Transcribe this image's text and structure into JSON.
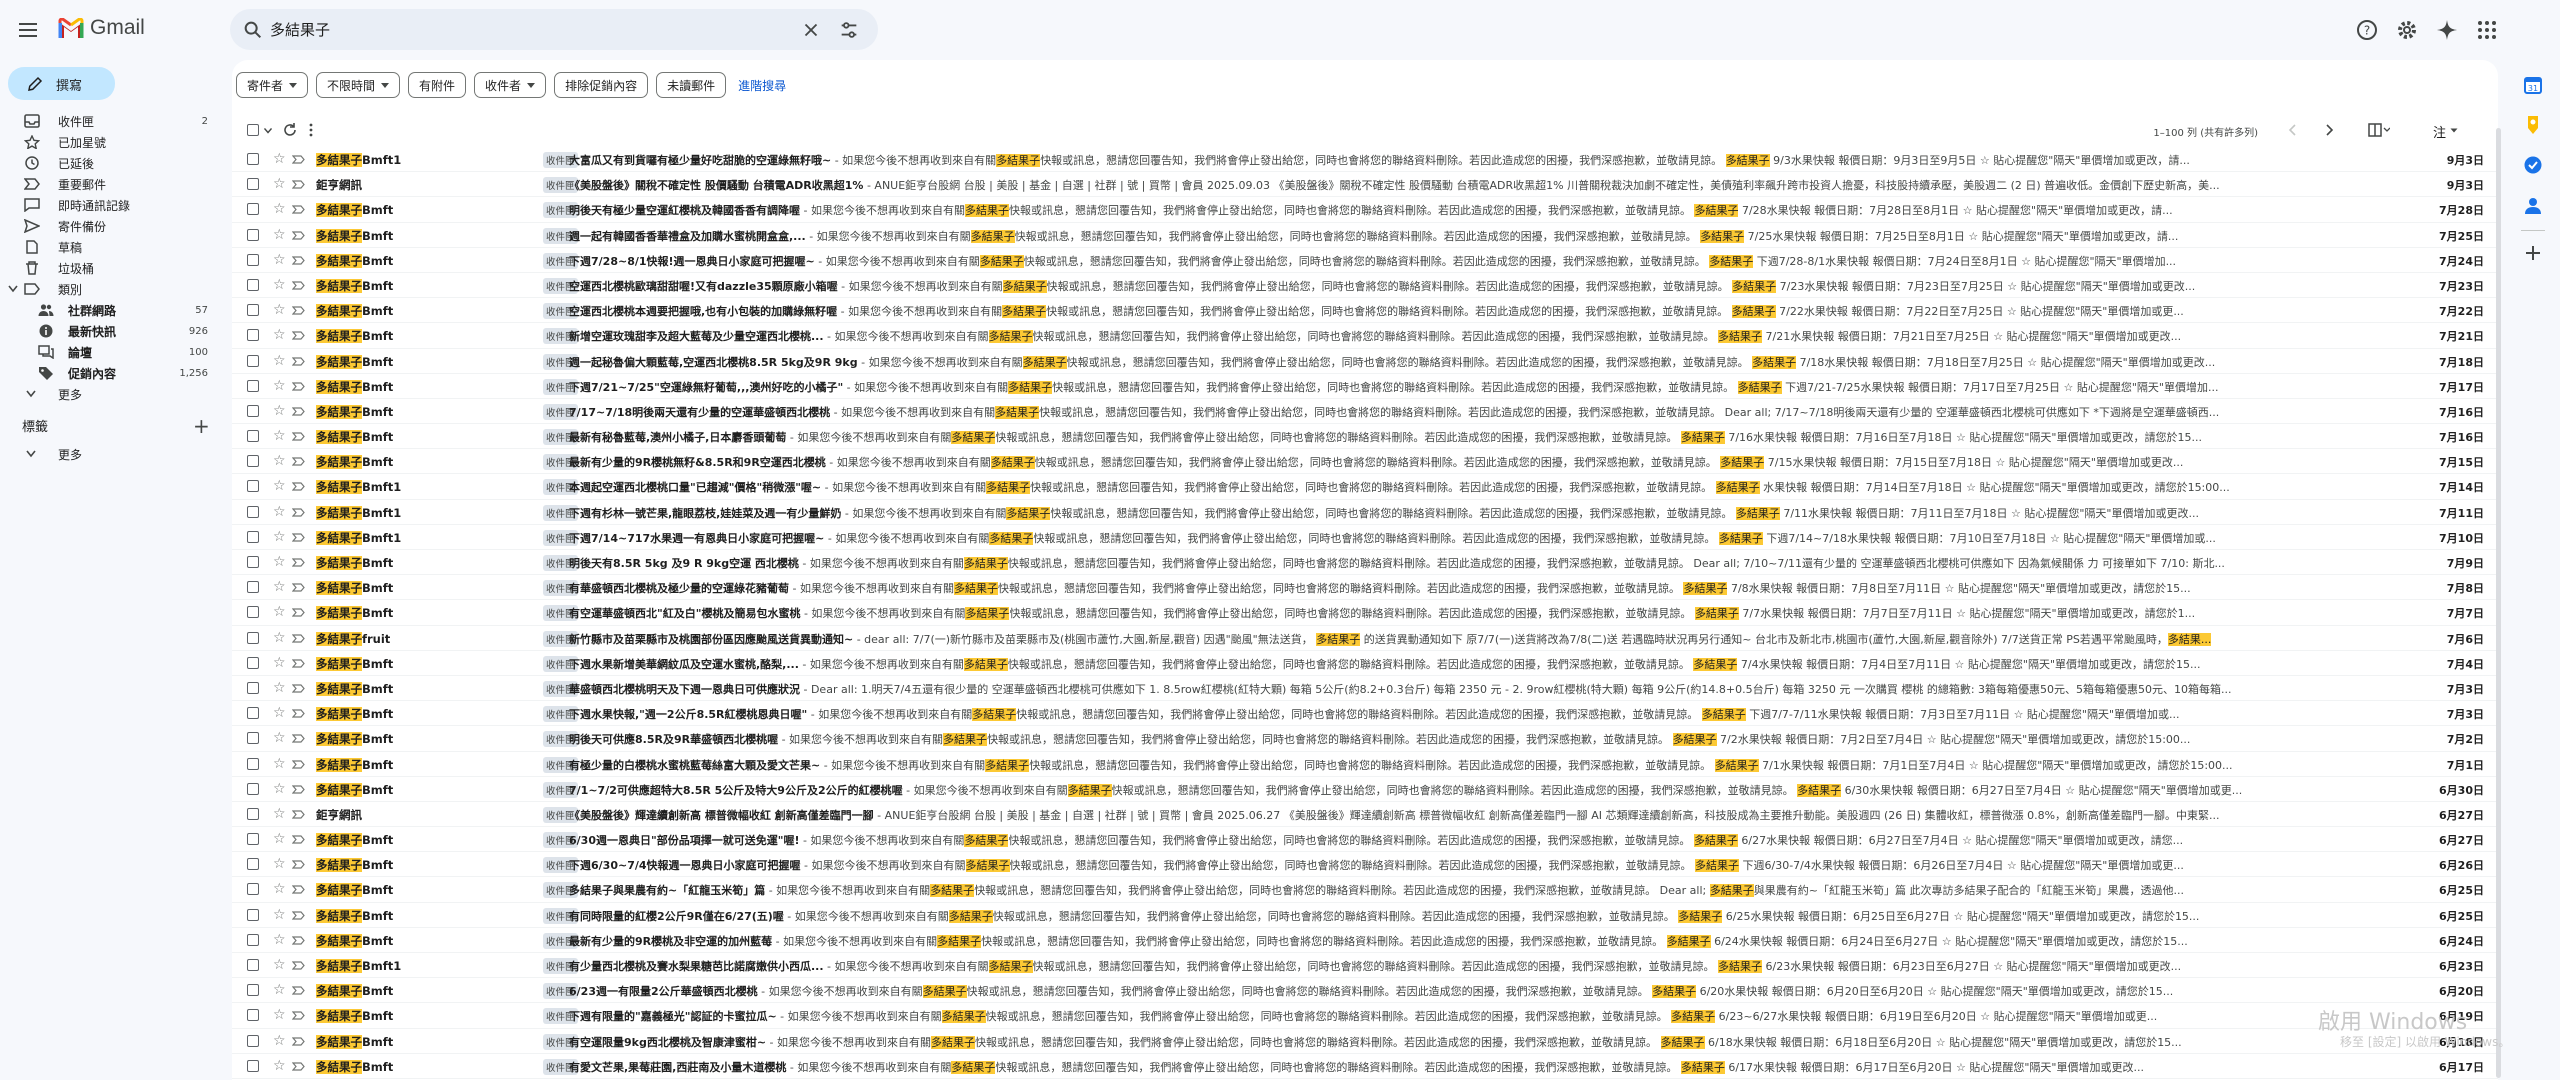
{
  "app": {
    "name": "Gmail"
  },
  "search": {
    "value": "多結果子"
  },
  "colors": {
    "accent": "#0b57d0",
    "highlight": "#fcc934",
    "compose_bg": "#c2e7ff"
  },
  "sidebar": {
    "compose": "撰寫",
    "items": [
      {
        "label": "收件匣",
        "count": "2",
        "icon": "inbox-icon"
      },
      {
        "label": "已加星號",
        "count": "",
        "icon": "star-icon"
      },
      {
        "label": "已延後",
        "count": "",
        "icon": "clock-icon"
      },
      {
        "label": "重要郵件",
        "count": "",
        "icon": "important-icon"
      },
      {
        "label": "即時通訊記錄",
        "count": "",
        "icon": "chat-icon"
      },
      {
        "label": "寄件備份",
        "count": "",
        "icon": "send-icon"
      },
      {
        "label": "草稿",
        "count": "",
        "icon": "draft-icon"
      },
      {
        "label": "垃圾桶",
        "count": "",
        "icon": "trash-icon"
      },
      {
        "label": "類別",
        "count": "",
        "icon": "label-icon"
      }
    ],
    "categories": [
      {
        "label": "社群網路",
        "count": "57",
        "icon": "people-icon"
      },
      {
        "label": "最新快訊",
        "count": "926",
        "icon": "info-icon"
      },
      {
        "label": "論壇",
        "count": "100",
        "icon": "forum-icon"
      },
      {
        "label": "促銷內容",
        "count": "1,256",
        "icon": "tag-icon"
      }
    ],
    "more": "更多",
    "labels_title": "標籤",
    "labels_more": "更多"
  },
  "filters": {
    "chips": [
      "寄件者",
      "不限時間",
      "有附件",
      "收件者",
      "排除促銷內容",
      "未讀郵件"
    ],
    "advanced": "進階搜尋"
  },
  "toolbar": {
    "range": "1–100 列 (共有許多列)",
    "sort": "注"
  },
  "inbox_badge": "收件匣",
  "rows": [
    {
      "sender_hl": "多結果子",
      "sender_rest": "Bmft1",
      "badge": true,
      "subject": "大富瓜又有到貨囉有極少量好吃甜脆的空運綠無籽哦~",
      "snippet_a": " - 如果您今後不想再收到來自有關",
      "snippet_hl": "多結果子",
      "snippet_b": "快報或訊息，懇請您回覆告知，我們將會停止發出給您，同時也會將您的聯絡資料刪除。若因此造成您的困擾，我們深感抱歉，並敬請見諒。 ",
      "tail_hl": "多結果子",
      "tail": " 9/3水果快報 報價日期：9月3日至9月5日 ☆ 貼心提醒您\"隔天\"單價增加或更改，請...",
      "date": "9月3日"
    },
    {
      "sender_hl": "",
      "sender_rest": "鉅亨網訊",
      "badge": true,
      "subject": "《美股盤後》關稅不確定性 股價騷動 台積電ADR收黑超1%",
      "snippet_a": " - ANUE鉅亨台股網 台股 | 美股 | 基金 | 自選 | 社群 | 號 | 買幣 | 會員 2025.09.03 《美股盤後》關稅不確定性 股價騷動 台積電ADR收黑超1% 川普關稅裁決加劇不確定性，美債殖利率飆升跨市投資人擔憂，科技股持續承壓，美股週二 (2 日) 普遍收低。金價創下歷史新高，美...",
      "snippet_hl": "",
      "snippet_b": "",
      "tail_hl": "",
      "tail": "",
      "date": "9月3日"
    },
    {
      "sender_hl": "多結果子",
      "sender_rest": "Bmft",
      "badge": true,
      "subject": "明後天有極少量空運紅櫻桃及韓國香香有調降喔",
      "snippet_a": " - 如果您今後不想再收到來自有關",
      "snippet_hl": "多結果子",
      "snippet_b": "快報或訊息，懇請您回覆告知，我們將會停止發出給您，同時也會將您的聯絡資料刪除。若因此造成您的困擾，我們深感抱歉，並敬請見諒。 ",
      "tail_hl": "多結果子",
      "tail": " 7/28水果快報 報價日期：7月28日至8月1日 ☆ 貼心提醒您\"隔天\"單價增加或更改，請...",
      "date": "7月28日"
    },
    {
      "sender_hl": "多結果子",
      "sender_rest": "Bmft",
      "badge": true,
      "subject": "週一起有韓國香香華禮盒及加購水蜜桃開盒盒,...",
      "snippet_a": " - 如果您今後不想再收到來自有關",
      "snippet_hl": "多結果子",
      "snippet_b": "快報或訊息，懇請您回覆告知，我們將會停止發出給您，同時也會將您的聯絡資料刪除。若因此造成您的困擾，我們深感抱歉，並敬請見諒。 ",
      "tail_hl": "多結果子",
      "tail": " 7/25水果快報 報價日期：7月25日至8月1日 ☆ 貼心提醒您\"隔天\"單價增加或更改，請...",
      "date": "7月25日"
    },
    {
      "sender_hl": "多結果子",
      "sender_rest": "Bmft",
      "badge": true,
      "subject": "下週7/28~8/1快報!週一恩典日小家庭可把握喔~",
      "snippet_a": " - 如果您今後不想再收到來自有關",
      "snippet_hl": "多結果子",
      "snippet_b": "快報或訊息，懇請您回覆告知，我們將會停止發出給您，同時也會將您的聯絡資料刪除。若因此造成您的困擾，我們深感抱歉，並敬請見諒。 ",
      "tail_hl": "多結果子",
      "tail": " 下週7/28-8/1水果快報 報價日期：7月24日至8月1日 ☆ 貼心提醒您\"隔天\"單價增加...",
      "date": "7月24日"
    },
    {
      "sender_hl": "多結果子",
      "sender_rest": "Bmft",
      "badge": true,
      "subject": "空運西北櫻桃歐璃甜甜喔!又有dazzle35顆原廠小箱喔",
      "snippet_a": " - 如果您今後不想再收到來自有關",
      "snippet_hl": "多結果子",
      "snippet_b": "快報或訊息，懇請您回覆告知，我們將會停止發出給您，同時也會將您的聯絡資料刪除。若因此造成您的困擾，我們深感抱歉，並敬請見諒。 ",
      "tail_hl": "多結果子",
      "tail": " 7/23水果快報 報價日期：7月23日至7月25日 ☆ 貼心提醒您\"隔天\"單價增加或更改...",
      "date": "7月23日"
    },
    {
      "sender_hl": "多結果子",
      "sender_rest": "Bmft",
      "badge": true,
      "subject": "空運西北櫻桃本週要把握哦,也有小包裝的加購綠無籽喔",
      "snippet_a": " - 如果您今後不想再收到來自有關",
      "snippet_hl": "多結果子",
      "snippet_b": "快報或訊息，懇請您回覆告知，我們將會停止發出給您，同時也會將您的聯絡資料刪除。若因此造成您的困擾，我們深感抱歉，並敬請見諒。 ",
      "tail_hl": "多結果子",
      "tail": " 7/22水果快報 報價日期：7月22日至7月25日 ☆ 貼心提醒您\"隔天\"單價增加或更...",
      "date": "7月22日"
    },
    {
      "sender_hl": "多結果子",
      "sender_rest": "Bmft",
      "badge": true,
      "subject": "新增空運玫瑰甜李及超大藍莓及少量空運西北櫻桃...",
      "snippet_a": " - 如果您今後不想再收到來自有關",
      "snippet_hl": "多結果子",
      "snippet_b": "快報或訊息，懇請您回覆告知，我們將會停止發出給您，同時也會將您的聯絡資料刪除。若因此造成您的困擾，我們深感抱歉，並敬請見諒。 ",
      "tail_hl": "多結果子",
      "tail": " 7/21水果快報 報價日期：7月21日至7月25日 ☆ 貼心提醒您\"隔天\"單價增加或更改...",
      "date": "7月21日"
    },
    {
      "sender_hl": "多結果子",
      "sender_rest": "Bmft",
      "badge": true,
      "subject": "週一起秘魯偏大顆藍莓,空運西北櫻桃8.5R 5kg及9R 9kg",
      "snippet_a": " - 如果您今後不想再收到來自有關",
      "snippet_hl": "多結果子",
      "snippet_b": "快報或訊息，懇請您回覆告知，我們將會停止發出給您，同時也會將您的聯絡資料刪除。若因此造成您的困擾，我們深感抱歉，並敬請見諒。 ",
      "tail_hl": "多結果子",
      "tail": " 7/18水果快報 報價日期：7月18日至7月25日 ☆ 貼心提醒您\"隔天\"單價增加或更改...",
      "date": "7月18日"
    },
    {
      "sender_hl": "多結果子",
      "sender_rest": "Bmft",
      "badge": true,
      "subject": "下週7/21~7/25\"空運綠無籽葡萄,,,澳州好吃的小橘子\"",
      "snippet_a": " - 如果您今後不想再收到來自有關",
      "snippet_hl": "多結果子",
      "snippet_b": "快報或訊息，懇請您回覆告知，我們將會停止發出給您，同時也會將您的聯絡資料刪除。若因此造成您的困擾，我們深感抱歉，並敬請見諒。 ",
      "tail_hl": "多結果子",
      "tail": " 下週7/21-7/25水果快報 報價日期：7月17日至7月25日 ☆ 貼心提醒您\"隔天\"單價增加...",
      "date": "7月17日"
    },
    {
      "sender_hl": "多結果子",
      "sender_rest": "Bmft",
      "badge": true,
      "subject": "7/17~7/18明後兩天還有少量的空運華盛頓西北櫻桃",
      "snippet_a": " - 如果您今後不想再收到來自有關",
      "snippet_hl": "多結果子",
      "snippet_b": "快報或訊息，懇請您回覆告知，我們將會停止發出給您，同時也會將您的聯絡資料刪除。若因此造成您的困擾，我們深感抱歉，並敬請見諒。 Dear all; 7/17~7/18明後兩天還有少量的 空運華盛頓西北櫻桃可供應如下 *下週將是空運華盛頓西...",
      "tail_hl": "",
      "tail": "",
      "date": "7月16日"
    },
    {
      "sender_hl": "多結果子",
      "sender_rest": "Bmft",
      "badge": true,
      "subject": "最新有秘魯藍莓,澳州小橘子,日本麝香頭葡萄",
      "snippet_a": " - 如果您今後不想再收到來自有關",
      "snippet_hl": "多結果子",
      "snippet_b": "快報或訊息，懇請您回覆告知，我們將會停止發出給您，同時也會將您的聯絡資料刪除。若因此造成您的困擾，我們深感抱歉，並敬請見諒。 ",
      "tail_hl": "多結果子",
      "tail": " 7/16水果快報 報價日期：7月16日至7月18日 ☆ 貼心提醒您\"隔天\"單價增加或更改，請您於15...",
      "date": "7月16日"
    },
    {
      "sender_hl": "多結果子",
      "sender_rest": "Bmft",
      "badge": true,
      "subject": "最新有少量的9R櫻桃無籽&8.5R和9R空運西北櫻桃",
      "snippet_a": " - 如果您今後不想再收到來自有關",
      "snippet_hl": "多結果子",
      "snippet_b": "快報或訊息，懇請您回覆告知，我們將會停止發出給您，同時也會將您的聯絡資料刪除。若因此造成您的困擾，我們深感抱歉，並敬請見諒。 ",
      "tail_hl": "多結果子",
      "tail": " 7/15水果快報 報價日期：7月15日至7月18日 ☆ 貼心提醒您\"隔天\"單價增加或更改...",
      "date": "7月15日"
    },
    {
      "sender_hl": "多結果子",
      "sender_rest": "Bmft1",
      "badge": true,
      "subject": "本週起空運西北櫻桃口量\"已趨減\"價格\"稍微漲\"喔~",
      "snippet_a": " - 如果您今後不想再收到來自有關",
      "snippet_hl": "多結果子",
      "snippet_b": "快報或訊息，懇請您回覆告知，我們將會停止發出給您，同時也會將您的聯絡資料刪除。若因此造成您的困擾，我們深感抱歉，並敬請見諒。 ",
      "tail_hl": "多結果子",
      "tail": " 水果快報 報價日期：7月14日至7月18日 ☆ 貼心提醒您\"隔天\"單價增加或更改，請您於15:00...",
      "date": "7月14日"
    },
    {
      "sender_hl": "多結果子",
      "sender_rest": "Bmft1",
      "badge": true,
      "subject": "下週有杉林一號芒果,龍眼荔枝,娃娃菜及週一有少量鮮奶",
      "snippet_a": " - 如果您今後不想再收到來自有關",
      "snippet_hl": "多結果子",
      "snippet_b": "快報或訊息，懇請您回覆告知，我們將會停止發出給您，同時也會將您的聯絡資料刪除。若因此造成您的困擾，我們深感抱歉，並敬請見諒。 ",
      "tail_hl": "多結果子",
      "tail": " 7/11水果快報 報價日期：7月11日至7月18日 ☆ 貼心提醒您\"隔天\"單價增加或更改...",
      "date": "7月11日"
    },
    {
      "sender_hl": "多結果子",
      "sender_rest": "Bmft1",
      "badge": true,
      "subject": "下週7/14~717水果週一有恩典日小家庭可把握喔~",
      "snippet_a": " - 如果您今後不想再收到來自有關",
      "snippet_hl": "多結果子",
      "snippet_b": "快報或訊息，懇請您回覆告知，我們將會停止發出給您，同時也會將您的聯絡資料刪除。若因此造成您的困擾，我們深感抱歉，並敬請見諒。 ",
      "tail_hl": "多結果子",
      "tail": " 下週7/14~7/18水果快報 報價日期：7月10日至7月18日 ☆ 貼心提醒您\"隔天\"單價增加或...",
      "date": "7月10日"
    },
    {
      "sender_hl": "多結果子",
      "sender_rest": "Bmft",
      "badge": true,
      "subject": "明後天有8.5R 5kg 及9 R 9kg空運 西北櫻桃",
      "snippet_a": " - 如果您今後不想再收到來自有關",
      "snippet_hl": "多結果子",
      "snippet_b": "快報或訊息，懇請您回覆告知，我們將會停止發出給您，同時也會將您的聯絡資料刪除。若因此造成您的困擾，我們深感抱歉，並敬請見諒。 Dear all; 7/10~7/11還有少量的 空運華盛頓西北櫻桃可供應如下 因為氣候關係 力 可接單如下 7/10: 斯北...",
      "tail_hl": "",
      "tail": "",
      "date": "7月9日"
    },
    {
      "sender_hl": "多結果子",
      "sender_rest": "Bmft",
      "badge": true,
      "subject": "有華盛頓西北櫻桃及極少量的空運綠花豬葡萄",
      "snippet_a": " - 如果您今後不想再收到來自有關",
      "snippet_hl": "多結果子",
      "snippet_b": "快報或訊息，懇請您回覆告知，我們將會停止發出給您，同時也會將您的聯絡資料刪除。若因此造成您的困擾，我們深感抱歉，並敬請見諒。 ",
      "tail_hl": "多結果子",
      "tail": " 7/8水果快報 報價日期：7月8日至7月11日 ☆ 貼心提醒您\"隔天\"單價增加或更改，請您於15...",
      "date": "7月8日"
    },
    {
      "sender_hl": "多結果子",
      "sender_rest": "Bmft",
      "badge": true,
      "subject": "有空運華盛頓西北\"紅及白\"櫻桃及簡易包水蜜桃",
      "snippet_a": " - 如果您今後不想再收到來自有關",
      "snippet_hl": "多結果子",
      "snippet_b": "快報或訊息，懇請您回覆告知，我們將會停止發出給您，同時也會將您的聯絡資料刪除。若因此造成您的困擾，我們深感抱歉，並敬請見諒。 ",
      "tail_hl": "多結果子",
      "tail": " 7/7水果快報 報價日期：7月7日至7月11日 ☆ 貼心提醒您\"隔天\"單價增加或更改，請您於1...",
      "date": "7月7日"
    },
    {
      "sender_hl": "多結果子",
      "sender_rest": "fruit",
      "badge": true,
      "subject": "新竹縣市及苗栗縣市及桃園部份區因應颱風送貨異動通知~",
      "snippet_a": " - dear all: 7/7(一)新竹縣市及苗栗縣市及(桃園市蘆竹,大園,新屋,觀音) 因遇\"颱風\"無法送貨， ",
      "snippet_hl": "多結果子",
      "snippet_b": " 的送貨異動通知如下 原7/7(一)送貨將改為7/8(二)送 若遇臨時狀況再另行通知~ 台北市及新北市,桃園市(蘆竹,大園,新屋,觀音除外) 7/7送貨正常 PS若遇平常颱風時，",
      "tail_hl": "多結果...",
      "tail": "",
      "date": "7月6日"
    },
    {
      "sender_hl": "多結果子",
      "sender_rest": "Bmft",
      "badge": true,
      "subject": "下週水果新增美華網紋瓜及空運水蜜桃,酪梨,...",
      "snippet_a": " - 如果您今後不想再收到來自有關",
      "snippet_hl": "多結果子",
      "snippet_b": "快報或訊息，懇請您回覆告知，我們將會停止發出給您，同時也會將您的聯絡資料刪除。若因此造成您的困擾，我們深感抱歉，並敬請見諒。 ",
      "tail_hl": "多結果子",
      "tail": " 7/4水果快報 報價日期：7月4日至7月11日 ☆ 貼心提醒您\"隔天\"單價增加或更改，請您於15...",
      "date": "7月4日"
    },
    {
      "sender_hl": "多結果子",
      "sender_rest": "Bmft",
      "badge": true,
      "subject": "華盛頓西北櫻桃明天及下週一恩典日可供應狀況",
      "snippet_a": " - Dear all: 1.明天7/4五還有很少量的 空運華盛頓西北櫻桃可供應如下 1. 8.5row紅櫻桃(紅特大顆) 每箱 5公斤(約8.2+0.3台斤) 每箱 2350 元 - 2. 9row紅櫻桃(特大顆) 每箱 9公斤(約14.8+0.5台斤) 每箱 3250 元 一次購買 櫻桃 的總箱數: 3箱每箱優惠50元、5箱每箱優惠50元、10箱每箱...",
      "snippet_hl": "",
      "snippet_b": "",
      "tail_hl": "",
      "tail": "",
      "date": "7月3日"
    },
    {
      "sender_hl": "多結果子",
      "sender_rest": "Bmft",
      "badge": true,
      "subject": "下週水果快報,\"週一2公斤8.5R紅櫻桃恩典日喔\"",
      "snippet_a": " - 如果您今後不想再收到來自有關",
      "snippet_hl": "多結果子",
      "snippet_b": "快報或訊息，懇請您回覆告知，我們將會停止發出給您，同時也會將您的聯絡資料刪除。若因此造成您的困擾，我們深感抱歉，並敬請見諒。 ",
      "tail_hl": "多結果子",
      "tail": " 下週7/7-7/11水果快報 報價日期：7月3日至7月11日 ☆ 貼心提醒您\"隔天\"單價增加或...",
      "date": "7月3日"
    },
    {
      "sender_hl": "多結果子",
      "sender_rest": "Bmft",
      "badge": true,
      "subject": "明後天可供應8.5R及9R華盛頓西北櫻桃喔",
      "snippet_a": " - 如果您今後不想再收到來自有關",
      "snippet_hl": "多結果子",
      "snippet_b": "快報或訊息，懇請您回覆告知，我們將會停止發出給您，同時也會將您的聯絡資料刪除。若因此造成您的困擾，我們深感抱歉，並敬請見諒。 ",
      "tail_hl": "多結果子",
      "tail": " 7/2水果快報 報價日期：7月2日至7月4日 ☆ 貼心提醒您\"隔天\"單價增加或更改，請您於15:00...",
      "date": "7月2日"
    },
    {
      "sender_hl": "多結果子",
      "sender_rest": "Bmft",
      "badge": true,
      "subject": "有極少量的白櫻桃水蜜桃藍莓絲富大顆及愛文芒果~",
      "snippet_a": " - 如果您今後不想再收到來自有關",
      "snippet_hl": "多結果子",
      "snippet_b": "快報或訊息，懇請您回覆告知，我們將會停止發出給您，同時也會將您的聯絡資料刪除。若因此造成您的困擾，我們深感抱歉，並敬請見諒。 ",
      "tail_hl": "多結果子",
      "tail": " 7/1水果快報 報價日期：7月1日至7月4日 ☆ 貼心提醒您\"隔天\"單價增加或更改，請您於15:00...",
      "date": "7月1日"
    },
    {
      "sender_hl": "多結果子",
      "sender_rest": "Bmft",
      "badge": true,
      "subject": "7/1~7/2可供應超特大8.5R 5公斤及特大9公斤及2公斤的紅櫻桃喔",
      "snippet_a": " - 如果您今後不想再收到來自有關",
      "snippet_hl": "多結果子",
      "snippet_b": "快報或訊息，懇請您回覆告知，我們將會停止發出給您，同時也會將您的聯絡資料刪除。若因此造成您的困擾，我們深感抱歉，並敬請見諒。 ",
      "tail_hl": "多結果子",
      "tail": " 6/30水果快報 報價日期：6月27日至7月4日 ☆ 貼心提醒您\"隔天\"單價增加或更...",
      "date": "6月30日"
    },
    {
      "sender_hl": "",
      "sender_rest": "鉅亨網訊",
      "badge": true,
      "subject": "《美股盤後》輝達續創新高 標普微幅收紅 創新高僅差臨門一腳",
      "snippet_a": " - ANUE鉅亨台股網 台股 | 美股 | 基金 | 自選 | 社群 | 號 | 買幣 | 會員 2025.06.27 《美股盤後》輝達續創新高 標普微幅收紅 創新高僅差臨門一腳 AI 芯類輝達續創新高，科技股成為主要推升動能。美股週四 (26 日) 集體收紅，標普微漲 0.8%，創新高僅差臨門一腳。中東緊...",
      "snippet_hl": "",
      "snippet_b": "",
      "tail_hl": "",
      "tail": "",
      "date": "6月27日"
    },
    {
      "sender_hl": "多結果子",
      "sender_rest": "Bmft",
      "badge": true,
      "subject": "6/30週一恩典日\"部份品項擇一就可送免運\"喔!",
      "snippet_a": " - 如果您今後不想再收到來自有關",
      "snippet_hl": "多結果子",
      "snippet_b": "快報或訊息，懇請您回覆告知，我們將會停止發出給您，同時也會將您的聯絡資料刪除。若因此造成您的困擾，我們深感抱歉，並敬請見諒。 ",
      "tail_hl": "多結果子",
      "tail": " 6/27水果快報 報價日期：6月27日至7月4日 ☆ 貼心提醒您\"隔天\"單價增加或更改，請您...",
      "date": "6月27日"
    },
    {
      "sender_hl": "多結果子",
      "sender_rest": "Bmft",
      "badge": true,
      "subject": "下週6/30~7/4快報週一恩典日小家庭可把握喔",
      "snippet_a": " - 如果您今後不想再收到來自有關",
      "snippet_hl": "多結果子",
      "snippet_b": "快報或訊息，懇請您回覆告知，我們將會停止發出給您，同時也會將您的聯絡資料刪除。若因此造成您的困擾，我們深感抱歉，並敬請見諒。 ",
      "tail_hl": "多結果子",
      "tail": " 下週6/30-7/4水果快報 報價日期：6月26日至7月4日 ☆ 貼心提醒您\"隔天\"單價增加或更...",
      "date": "6月26日"
    },
    {
      "sender_hl": "多結果子",
      "sender_rest": "Bmft",
      "badge": true,
      "subject": "多結果子與果農有約~「紅龍玉米筍」篇",
      "snippet_a": " - 如果您今後不想再收到來自有關",
      "snippet_hl": "多結果子",
      "snippet_b": "快報或訊息，懇請您回覆告知，我們將會停止發出給您，同時也會將您的聯絡資料刪除。若因此造成您的困擾，我們深感抱歉，並敬請見諒。 Dear all; ",
      "tail_hl": "多結果子",
      "tail": "與果農有約~「紅龍玉米筍」篇 此次專訪多結果子配合的「紅龍玉米筍」果農，透過他...",
      "date": "6月25日"
    },
    {
      "sender_hl": "多結果子",
      "sender_rest": "Bmft",
      "badge": true,
      "subject": "有同時限量的紅櫻2公斤9R僅在6/27(五)喔",
      "snippet_a": " - 如果您今後不想再收到來自有關",
      "snippet_hl": "多結果子",
      "snippet_b": "快報或訊息，懇請您回覆告知，我們將會停止發出給您，同時也會將您的聯絡資料刪除。若因此造成您的困擾，我們深感抱歉，並敬請見諒。 ",
      "tail_hl": "多結果子",
      "tail": " 6/25水果快報 報價日期：6月25日至6月27日 ☆ 貼心提醒您\"隔天\"單價增加或更改，請您於15...",
      "date": "6月25日"
    },
    {
      "sender_hl": "多結果子",
      "sender_rest": "Bmft",
      "badge": true,
      "subject": "最新有少量的9R櫻桃及非空運的加州藍莓",
      "snippet_a": " - 如果您今後不想再收到來自有關",
      "snippet_hl": "多結果子",
      "snippet_b": "快報或訊息，懇請您回覆告知，我們將會停止發出給您，同時也會將您的聯絡資料刪除。若因此造成您的困擾，我們深感抱歉，並敬請見諒。 ",
      "tail_hl": "多結果子",
      "tail": " 6/24水果快報 報價日期：6月24日至6月27日 ☆ 貼心提醒您\"隔天\"單價增加或更改，請您於15...",
      "date": "6月24日"
    },
    {
      "sender_hl": "多結果子",
      "sender_rest": "Bmft1",
      "badge": true,
      "subject": "有少量西北櫻桃及賽水梨果糖芭比諾腐嫩供小西瓜...",
      "snippet_a": " - 如果您今後不想再收到來自有關",
      "snippet_hl": "多結果子",
      "snippet_b": "快報或訊息，懇請您回覆告知，我們將會停止發出給您，同時也會將您的聯絡資料刪除。若因此造成您的困擾，我們深感抱歉，並敬請見諒。 ",
      "tail_hl": "多結果子",
      "tail": " 6/23水果快報 報價日期：6月23日至6月27日 ☆ 貼心提醒您\"隔天\"單價增加或更改...",
      "date": "6月23日"
    },
    {
      "sender_hl": "多結果子",
      "sender_rest": "Bmft",
      "badge": true,
      "subject": "6/23週一有限量2公斤華盛頓西北櫻桃",
      "snippet_a": " - 如果您今後不想再收到來自有關",
      "snippet_hl": "多結果子",
      "snippet_b": "快報或訊息，懇請您回覆告知，我們將會停止發出給您，同時也會將您的聯絡資料刪除。若因此造成您的困擾，我們深感抱歉，並敬請見諒。 ",
      "tail_hl": "多結果子",
      "tail": " 6/20水果快報 報價日期：6月20日至6月20日 ☆ 貼心提醒您\"隔天\"單價增加或更改，請您於15...",
      "date": "6月20日"
    },
    {
      "sender_hl": "多結果子",
      "sender_rest": "Bmft",
      "badge": true,
      "subject": "下週有限量的\"嘉義極光\"認証的卡蜜拉瓜~",
      "snippet_a": " - 如果您今後不想再收到來自有關",
      "snippet_hl": "多結果子",
      "snippet_b": "快報或訊息，懇請您回覆告知，我們將會停止發出給您，同時也會將您的聯絡資料刪除。若因此造成您的困擾，我們深感抱歉，並敬請見諒。 ",
      "tail_hl": "多結果子",
      "tail": " 6/23~6/27水果快報 報價日期：6月19日至6月20日 ☆ 貼心提醒您\"隔天\"單價增加或更...",
      "date": "6月19日"
    },
    {
      "sender_hl": "多結果子",
      "sender_rest": "Bmft",
      "badge": true,
      "subject": "有空運限量9kg西北櫻桃及智康津蜜柑~",
      "snippet_a": " - 如果您今後不想再收到來自有關",
      "snippet_hl": "多結果子",
      "snippet_b": "快報或訊息，懇請您回覆告知，我們將會停止發出給您，同時也會將您的聯絡資料刪除。若因此造成您的困擾，我們深感抱歉，並敬請見諒。 ",
      "tail_hl": "多結果子",
      "tail": " 6/18水果快報 報價日期：6月18日至6月20日 ☆ 貼心提醒您\"隔天\"單價增加或更改，請您於15...",
      "date": "6月18日"
    },
    {
      "sender_hl": "多結果子",
      "sender_rest": "Bmft",
      "badge": true,
      "subject": "有愛文芒果,果莓莊園,西莊南及小量木道櫻桃",
      "snippet_a": " - 如果您今後不想再收到來自有關",
      "snippet_hl": "多結果子",
      "snippet_b": "快報或訊息，懇請您回覆告知，我們將會停止發出給您，同時也會將您的聯絡資料刪除。若因此造成您的困擾，我們深感抱歉，並敬請見諒。 ",
      "tail_hl": "多結果子",
      "tail": " 6/17水果快報 報價日期：6月17日至6月20日 ☆ 貼心提醒您\"隔天\"單價增加或更改...",
      "date": "6月17日"
    }
  ],
  "watermark": {
    "line1": "啟用 Windows",
    "line2": "移至 [設定] 以啟用 Windows。"
  }
}
